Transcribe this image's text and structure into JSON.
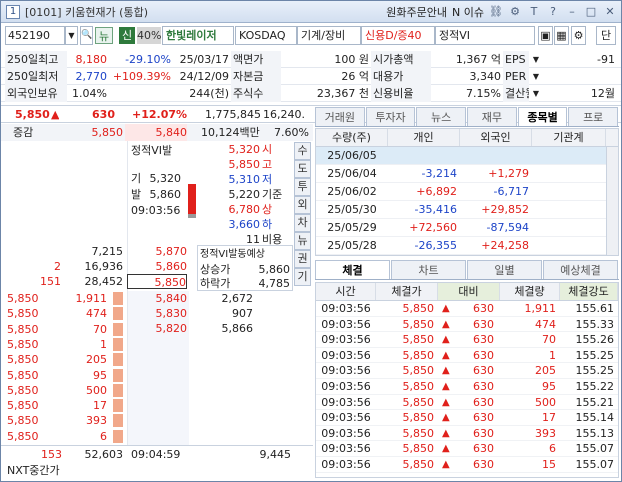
{
  "titlebar": {
    "num": "1",
    "title": "[0101] 키움현재가 (통합)",
    "menu1": "원화주문안내",
    "menu2": "N 이슈"
  },
  "toolbar": {
    "code": "452190",
    "btn_new": "뉴",
    "btn_credit": "신",
    "margin": "40%",
    "name": "한빛레이저",
    "market": "KOSDAQ",
    "sector": "기계/장비",
    "credit_info": "신용D/증40",
    "vi_status": "정적VI",
    "single_btn": "단"
  },
  "info": {
    "rows": [
      {
        "l1": "250일최고",
        "v1": "8,180",
        "p1": "-29.10%",
        "d1": "25/03/17",
        "l2": "액면가",
        "v2": "100 원",
        "l3": "시가총액",
        "v3": "1,367 억",
        "l4": "EPS",
        "v4": "-91"
      },
      {
        "l1": "250일최저",
        "v1": "2,770",
        "p1": "+109.39%",
        "d1": "24/12/09",
        "l2": "자본금",
        "v2": "26 억",
        "l3": "대용가",
        "v3": "3,340",
        "l4": "PER",
        "v4": ""
      },
      {
        "l1": "외국인보유",
        "v1": "1.04%",
        "p1": "",
        "d1": "244(천)",
        "l2": "주식수",
        "v2": "23,367 천",
        "l3": "신용비율",
        "v3": "7.15%",
        "l4": "결산월",
        "v4": "12월"
      }
    ]
  },
  "price": {
    "current": "5,850",
    "change": "630",
    "rate": "+12.07%",
    "volume": "1,775,845",
    "vol_rate": "16,240."
  },
  "orderbook": {
    "label_change": "증감",
    "top_ask": "5,850",
    "top_price": "5,840",
    "amount": "10,124백만",
    "amount_pct": "7.60%",
    "vi_title": "정적VI발",
    "vi_base_label": "기",
    "vi_base": "5,320",
    "vi_trig_label": "발",
    "vi_trig": "5,860",
    "vi_time": "09:03:56",
    "ohlc": [
      {
        "v": "5,320",
        "l": "시"
      },
      {
        "v": "5,850",
        "l": "고"
      },
      {
        "v": "5,310",
        "l": "저"
      },
      {
        "v": "5,220",
        "l": "기준"
      },
      {
        "v": "6,780",
        "l": "상"
      },
      {
        "v": "3,660",
        "l": "하"
      },
      {
        "v": "11",
        "l": "비용"
      }
    ],
    "side_tabs": [
      "수",
      "도",
      "투",
      "외",
      "차",
      "뉴",
      "권",
      "기"
    ],
    "asks": [
      {
        "chg": "",
        "qty": "7,215",
        "price": "5,870"
      },
      {
        "chg": "2",
        "qty": "16,936",
        "price": "5,860"
      },
      {
        "chg": "151",
        "qty": "28,452",
        "price": "5,850"
      }
    ],
    "vi_expect": "정적VI발동예상",
    "vi_up_label": "상승가",
    "vi_up": "5,860",
    "vi_down_label": "하락가",
    "vi_down": "4,785",
    "bids": [
      {
        "price": "5,840",
        "qty": "2,672"
      },
      {
        "price": "5,830",
        "qty": "907"
      },
      {
        "price": "5,820",
        "qty": "5,866"
      }
    ],
    "trades": [
      {
        "p": "5,850",
        "q": "1,911"
      },
      {
        "p": "5,850",
        "q": "474"
      },
      {
        "p": "5,850",
        "q": "70"
      },
      {
        "p": "5,850",
        "q": "1"
      },
      {
        "p": "5,850",
        "q": "205"
      },
      {
        "p": "5,850",
        "q": "95"
      },
      {
        "p": "5,850",
        "q": "500"
      },
      {
        "p": "5,850",
        "q": "17"
      },
      {
        "p": "5,850",
        "q": "393"
      },
      {
        "p": "5,850",
        "q": "6"
      }
    ],
    "foot_left": "153",
    "foot_total": "52,603",
    "foot_time": "09:04:59",
    "foot_right": "9,445",
    "nxt_label": "NXT중간가"
  },
  "right_tabs": [
    "거래원",
    "투자자",
    "뉴스",
    "재무",
    "종목별",
    "프로"
  ],
  "investor": {
    "headers": [
      "수량(주)",
      "개인",
      "외국인",
      "기관계"
    ],
    "rows": [
      {
        "date": "25/06/05",
        "ind": "",
        "frn": "",
        "inst": ""
      },
      {
        "date": "25/06/04",
        "ind": "-3,214",
        "frn": "+1,279",
        "inst": ""
      },
      {
        "date": "25/06/02",
        "ind": "+6,892",
        "frn": "-6,717",
        "inst": ""
      },
      {
        "date": "25/05/30",
        "ind": "-35,416",
        "frn": "+29,852",
        "inst": ""
      },
      {
        "date": "25/05/29",
        "ind": "+72,560",
        "frn": "-87,594",
        "inst": ""
      },
      {
        "date": "25/05/28",
        "ind": "-26,355",
        "frn": "+24,258",
        "inst": ""
      }
    ]
  },
  "tick_tabs": [
    "체결",
    "차트",
    "일별",
    "예상체결"
  ],
  "ticks": {
    "headers": [
      "시간",
      "체결가",
      "대비",
      "체결량",
      "체결강도"
    ],
    "rows": [
      {
        "t": "09:03:56",
        "p": "5,850",
        "d": "630",
        "q": "1,911",
        "s": "155.61"
      },
      {
        "t": "09:03:56",
        "p": "5,850",
        "d": "630",
        "q": "474",
        "s": "155.33"
      },
      {
        "t": "09:03:56",
        "p": "5,850",
        "d": "630",
        "q": "70",
        "s": "155.26"
      },
      {
        "t": "09:03:56",
        "p": "5,850",
        "d": "630",
        "q": "1",
        "s": "155.25"
      },
      {
        "t": "09:03:56",
        "p": "5,850",
        "d": "630",
        "q": "205",
        "s": "155.25"
      },
      {
        "t": "09:03:56",
        "p": "5,850",
        "d": "630",
        "q": "95",
        "s": "155.22"
      },
      {
        "t": "09:03:56",
        "p": "5,850",
        "d": "630",
        "q": "500",
        "s": "155.21"
      },
      {
        "t": "09:03:56",
        "p": "5,850",
        "d": "630",
        "q": "17",
        "s": "155.14"
      },
      {
        "t": "09:03:56",
        "p": "5,850",
        "d": "630",
        "q": "393",
        "s": "155.13"
      },
      {
        "t": "09:03:56",
        "p": "5,850",
        "d": "630",
        "q": "6",
        "s": "155.07"
      },
      {
        "t": "09:03:56",
        "p": "5,850",
        "d": "630",
        "q": "15",
        "s": "155.07"
      }
    ]
  },
  "colors": {
    "up": "#e0201b",
    "down": "#1d44c8",
    "accent": "#2e7a3c"
  }
}
